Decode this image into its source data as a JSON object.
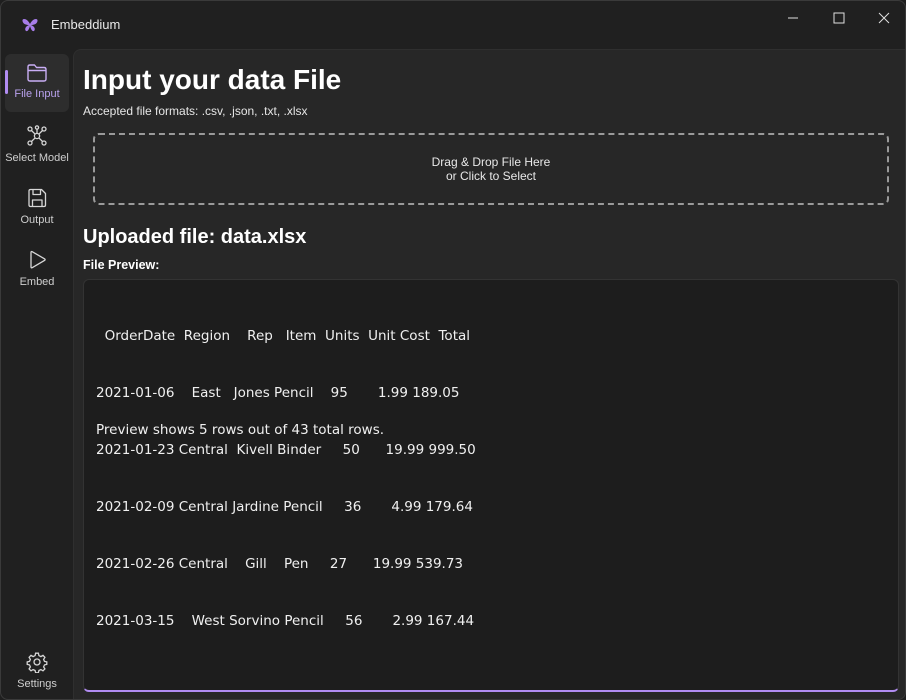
{
  "app": {
    "title": "Embeddium"
  },
  "sidebar": {
    "items": [
      {
        "label": "File Input",
        "icon": "folder-icon",
        "active": true
      },
      {
        "label": "Select Model",
        "icon": "network-icon",
        "active": false
      },
      {
        "label": "Output",
        "icon": "save-icon",
        "active": false
      },
      {
        "label": "Embed",
        "icon": "play-icon",
        "active": false
      }
    ],
    "settings_label": "Settings"
  },
  "main": {
    "title": "Input your data File",
    "formats": "Accepted file formats: .csv, .json, .txt, .xlsx",
    "dropzone": {
      "line1": "Drag & Drop File Here",
      "line2": "or Click to Select"
    },
    "uploaded": "Uploaded file: data.xlsx",
    "preview_label": "File Preview:",
    "preview_lines": [
      "  OrderDate  Region    Rep   Item  Units  Unit Cost  Total",
      "2021-01-06    East   Jones Pencil    95       1.99 189.05",
      "2021-01-23 Central  Kivell Binder     50      19.99 999.50",
      "2021-02-09 Central Jardine Pencil     36       4.99 179.64",
      "2021-02-26 Central    Gill    Pen     27      19.99 539.73",
      "2021-03-15    West Sorvino Pencil     56       2.99 167.44"
    ],
    "preview_note": "Preview shows 5 rows out of 43 total rows."
  },
  "colors": {
    "accent": "#b18cf2",
    "background": "#202020",
    "panel": "#272727"
  }
}
